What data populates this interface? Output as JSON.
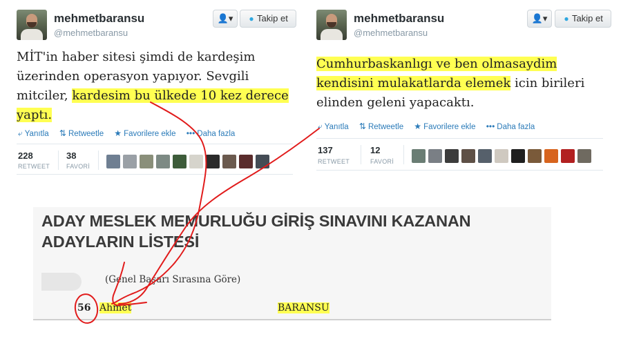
{
  "tweets": [
    {
      "name": "mehmetbaransu",
      "handle": "@mehmetbaransu",
      "user_btn_label": "▾",
      "follow_label": "Takip et",
      "text_lines": [
        {
          "plain1": "MİT'in haber sitesi şimdi de kardeşim",
          "mark": "",
          "plain2": ""
        },
        {
          "plain1": "üzerinden operasyon yapıyor. Sevgili",
          "mark": "",
          "plain2": ""
        },
        {
          "plain1": "mitciler, ",
          "mark": "kardesim bu ülkede 10 kez derece",
          "plain2": ""
        },
        {
          "plain1": "",
          "mark": "yaptı.",
          "plain2": ""
        }
      ],
      "actions": {
        "reply": "Yanıtla",
        "retweet": "Retweetle",
        "favorite": "Favorilere ekle",
        "more": "Daha fazla"
      },
      "retweet_count": "228",
      "retweet_label": "RETWEET",
      "fav_count": "38",
      "fav_label": "FAVORİ"
    },
    {
      "name": "mehmetbaransu",
      "handle": "@mehmetbaransu",
      "user_btn_label": "▾",
      "follow_label": "Takip et",
      "text_lines": [
        {
          "plain1": "",
          "mark": "Cumhurbaskanlıgı ve ben olmasaydim",
          "plain2": ""
        },
        {
          "plain1": "",
          "mark": "kendisini mulakatlarda elemek",
          "plain2": " icin birileri"
        },
        {
          "plain1": "elinden geleni yapacaktı.",
          "mark": "",
          "plain2": ""
        }
      ],
      "actions": {
        "reply": "Yanıtla",
        "retweet": "Retweetle",
        "favorite": "Favorilere ekle",
        "more": "Daha fazla"
      },
      "retweet_count": "137",
      "retweet_label": "RETWEET",
      "fav_count": "12",
      "fav_label": "FAVORİ"
    }
  ],
  "document": {
    "title_line1": "ADAY MESLEK MEMURLUĞU GİRİŞ SINAVINI KAZANAN",
    "title_line2": "ADAYLARIN LİSTESİ",
    "subtitle": "(Genel Başarı Sırasına Göre)",
    "rank": "56",
    "first_name": "Ahmet",
    "last_name": "BARANSU"
  },
  "colors": {
    "highlight": "#ffff52",
    "link": "#2b7bb9",
    "annotation": "#e11b1b"
  },
  "icons": [
    "user-icon",
    "twitter-bird-icon",
    "reply-icon",
    "retweet-icon",
    "star-icon",
    "more-icon"
  ]
}
